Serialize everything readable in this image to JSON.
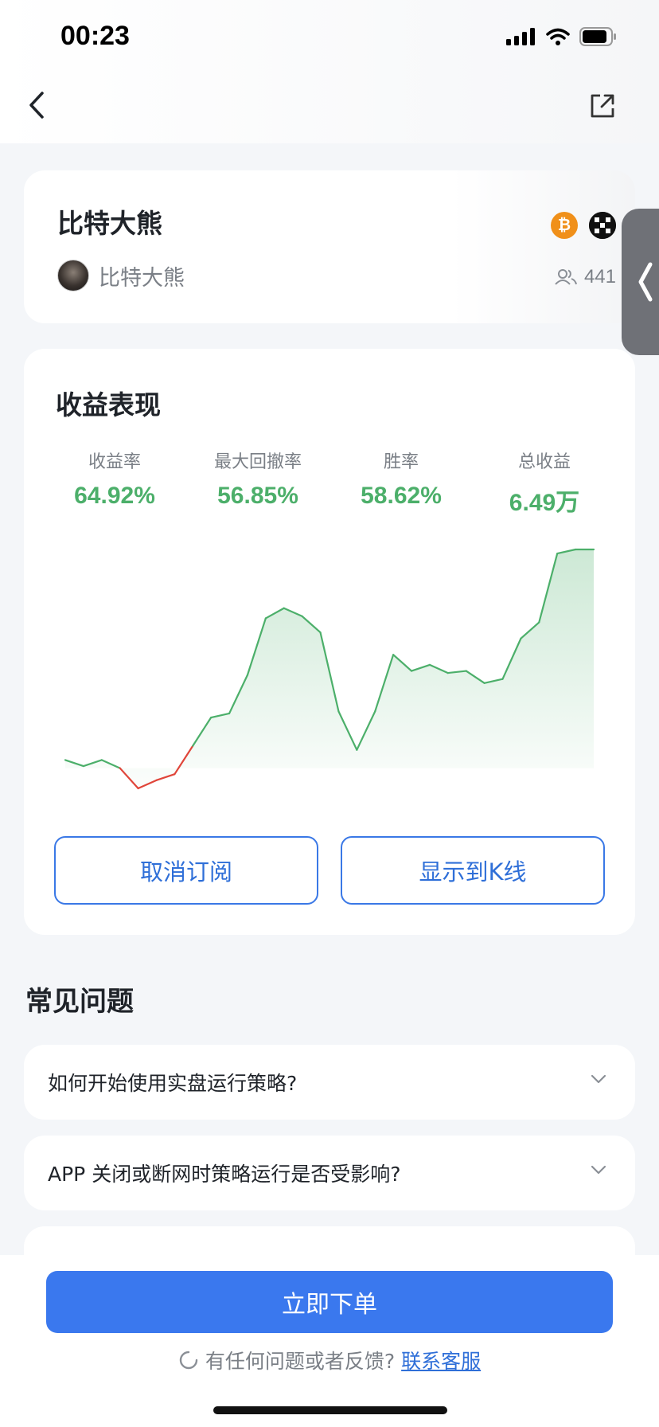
{
  "status_bar": {
    "time": "00:23"
  },
  "header": {
    "back_icon": "chevron-left-icon",
    "share_icon": "share-icon"
  },
  "profile": {
    "strategy_name": "比特大熊",
    "author_name": "比特大熊",
    "followers": "441",
    "coins": [
      "bitcoin-icon",
      "okx-icon"
    ]
  },
  "performance": {
    "title": "收益表现",
    "stats": [
      {
        "label": "收益率",
        "value": "64.92%"
      },
      {
        "label": "最大回撤率",
        "value": "56.85%"
      },
      {
        "label": "胜率",
        "value": "58.62%"
      },
      {
        "label": "总收益",
        "value": "6.49万"
      }
    ],
    "unsubscribe_label": "取消订阅",
    "show_kline_label": "显示到K线"
  },
  "chart_data": {
    "type": "line",
    "title": "",
    "xlabel": "",
    "ylabel": "",
    "baseline": 0,
    "colors": {
      "positive": "#4caf6a",
      "negative": "#e0453a"
    },
    "values": [
      4,
      1,
      4,
      0,
      -10,
      -6,
      -3,
      11,
      25,
      27,
      46,
      74,
      79,
      75,
      67,
      28,
      9,
      28,
      56,
      48,
      51,
      47,
      48,
      42,
      44,
      64,
      72,
      106,
      108,
      108
    ]
  },
  "faq": {
    "title": "常见问题",
    "items": [
      "如何开始使用实盘运行策略?",
      "APP 关闭或断网时策略运行是否受影响?"
    ]
  },
  "footer": {
    "order_label": "立即下单",
    "help_text": "有任何问题或者反馈?",
    "help_link": "联系客服"
  }
}
